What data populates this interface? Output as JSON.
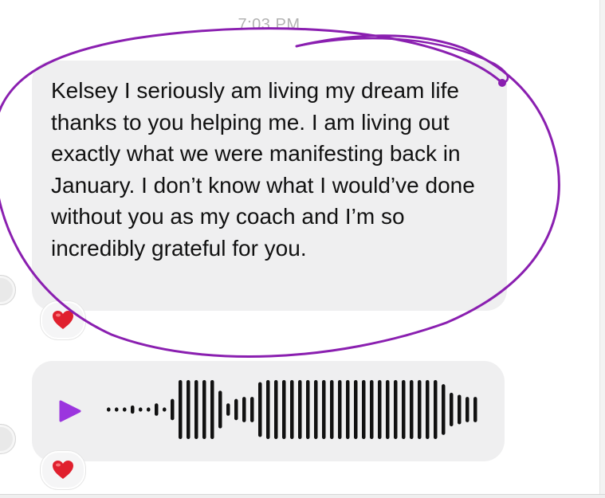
{
  "conversation": {
    "timestamp": "7:03 PM",
    "messages": [
      {
        "type": "text",
        "text": "Kelsey I seriously am living my dream life thanks to you helping me. I am living out exactly what we were manifesting back in January. I don’t know what I would’ve done without you as my coach and I’m so incredibly grateful for you.",
        "reaction": "❤️"
      },
      {
        "type": "voice",
        "icon": "play-icon",
        "reaction": "❤️",
        "waveform_levels": [
          0.07,
          0.07,
          0.07,
          0.14,
          0.07,
          0.07,
          0.21,
          0.07,
          0.36,
          1.0,
          1.0,
          1.0,
          1.0,
          1.0,
          0.64,
          0.21,
          0.36,
          0.43,
          0.43,
          0.93,
          1.0,
          1.0,
          1.0,
          1.0,
          1.0,
          1.0,
          1.0,
          1.0,
          1.0,
          1.0,
          1.0,
          1.0,
          1.0,
          1.0,
          1.0,
          1.0,
          1.0,
          1.0,
          1.0,
          1.0,
          1.0,
          1.0,
          0.86,
          0.57,
          0.5,
          0.43,
          0.43
        ]
      }
    ]
  },
  "colors": {
    "bubble": "#efeff0",
    "play": "#9b35de",
    "annotation_ring": "#8a1fb0",
    "timestamp": "#b3b3b3"
  }
}
